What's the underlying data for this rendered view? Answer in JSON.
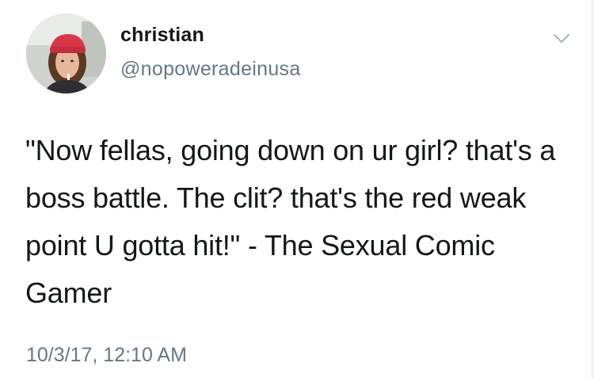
{
  "tweet": {
    "author": {
      "display_name": "christian",
      "handle": "@nopoweradeinusa"
    },
    "text": "\"Now fellas, going down on ur girl? that's a boss battle. The clit? that's the red weak point U gotta hit!\" - The Sexual Comic Gamer",
    "timestamp": "10/3/17, 12:10 AM",
    "menu_icon": "chevron-down-icon",
    "colors": {
      "name": "#14171a",
      "secondary": "#657786",
      "chevron": "#aab8c2"
    }
  }
}
